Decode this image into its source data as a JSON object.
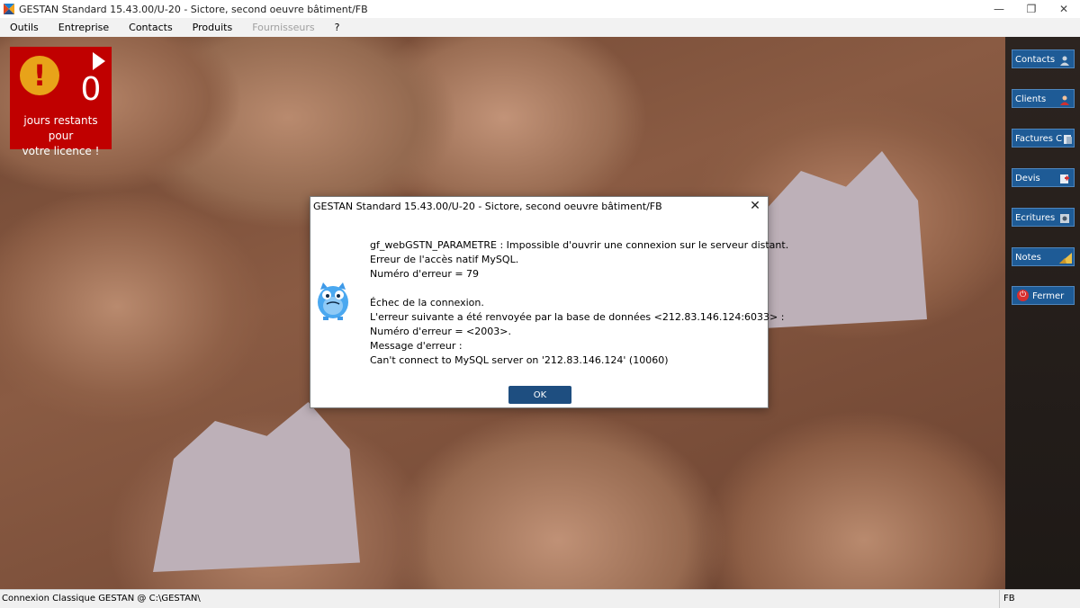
{
  "window": {
    "title": "GESTAN Standard 15.43.00/U-20 - Sictore, second oeuvre bâtiment/FB",
    "minimize": "—",
    "restore": "❐",
    "close": "✕"
  },
  "menu": {
    "items": [
      "Outils",
      "Entreprise",
      "Contacts",
      "Produits",
      "Fournisseurs",
      "?"
    ],
    "disabled": "Fournisseurs"
  },
  "license": {
    "count": "0",
    "text_line1": "jours restants pour",
    "text_line2": "votre licence !",
    "badge_color": "#c00000",
    "warning_color": "#e8a319"
  },
  "sidebar": {
    "buttons": [
      {
        "label": "Contacts",
        "icon": "person-icon"
      },
      {
        "label": "Clients",
        "icon": "client-icon"
      },
      {
        "label": "Factures C",
        "icon": "invoice-icon"
      },
      {
        "label": "Devis",
        "icon": "quote-icon"
      },
      {
        "label": "Ecritures",
        "icon": "ledger-icon"
      },
      {
        "label": "Notes",
        "icon": "note-icon"
      },
      {
        "label": "Fermer",
        "icon": "power-icon"
      }
    ],
    "button_color": "#1e5b96"
  },
  "dialog": {
    "title": "GESTAN Standard 15.43.00/U-20 - Sictore, second oeuvre bâtiment/FB",
    "close": "✕",
    "lines": [
      "gf_webGSTN_PARAMETRE : Impossible d'ouvrir une connexion sur le serveur distant.",
      "Erreur de l'accès natif MySQL.",
      "Numéro d'erreur = 79",
      "Échec de la connexion.",
      "L'erreur suivante a été renvoyée par la base de données <212.83.146.124:6033> :",
      "Numéro d'erreur = <2003>.",
      "Message d'erreur :",
      "Can't connect to MySQL server on '212.83.146.124' (10060)"
    ],
    "ok_label": "OK",
    "ok_color": "#1e4e80"
  },
  "status": {
    "left": "Connexion Classique GESTAN @ C:\\GESTAN\\",
    "right": "FB"
  }
}
